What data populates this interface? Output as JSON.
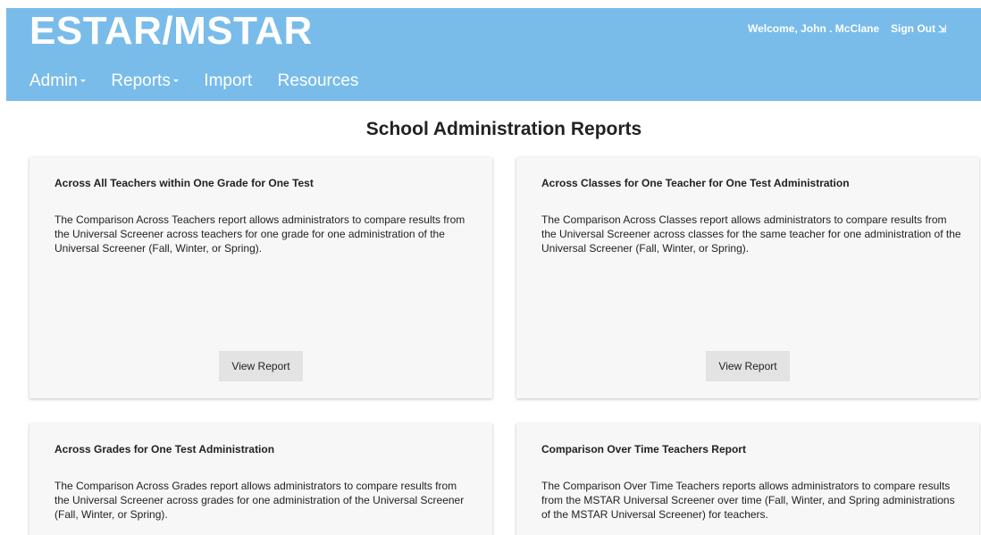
{
  "header": {
    "brand": "ESTAR/MSTAR",
    "welcome": "Welcome, John . McClane",
    "sign_out": "Sign Out"
  },
  "nav": {
    "items": [
      {
        "label": "Admin",
        "dropdown": true
      },
      {
        "label": "Reports",
        "dropdown": true
      },
      {
        "label": "Import",
        "dropdown": false
      },
      {
        "label": "Resources",
        "dropdown": false
      }
    ]
  },
  "main": {
    "title": "School Administration Reports",
    "cards": [
      {
        "title": "Across All Teachers within One Grade for One Test",
        "description": "The Comparison Across Teachers report allows administrators to compare results from the Universal Screener across teachers for one grade for one administration of the Universal Screener (Fall, Winter, or Spring).",
        "button": "View Report"
      },
      {
        "title": "Across Classes for One Teacher for One Test Administration",
        "description": "The Comparison Across Classes report allows administrators to compare results from the Universal Screener across classes for the same teacher for one administration of the Universal Screener (Fall, Winter, or Spring).",
        "button": "View Report"
      },
      {
        "title": "Across Grades for One Test Administration",
        "description": "The Comparison Across Grades report allows administrators to compare results from the Universal Screener across grades for one administration of the Universal Screener (Fall, Winter, or Spring)."
      },
      {
        "title": "Comparison Over Time Teachers Report",
        "description": "The Comparison Over Time Teachers reports allows administrators to compare results from the MSTAR Universal Screener over time (Fall, Winter, and Spring administrations of the MSTAR Universal Screener) for teachers."
      }
    ]
  },
  "colors": {
    "header_bg": "#79bcea",
    "card_bg": "#f7f7f7",
    "button_bg": "#e3e3e3"
  }
}
